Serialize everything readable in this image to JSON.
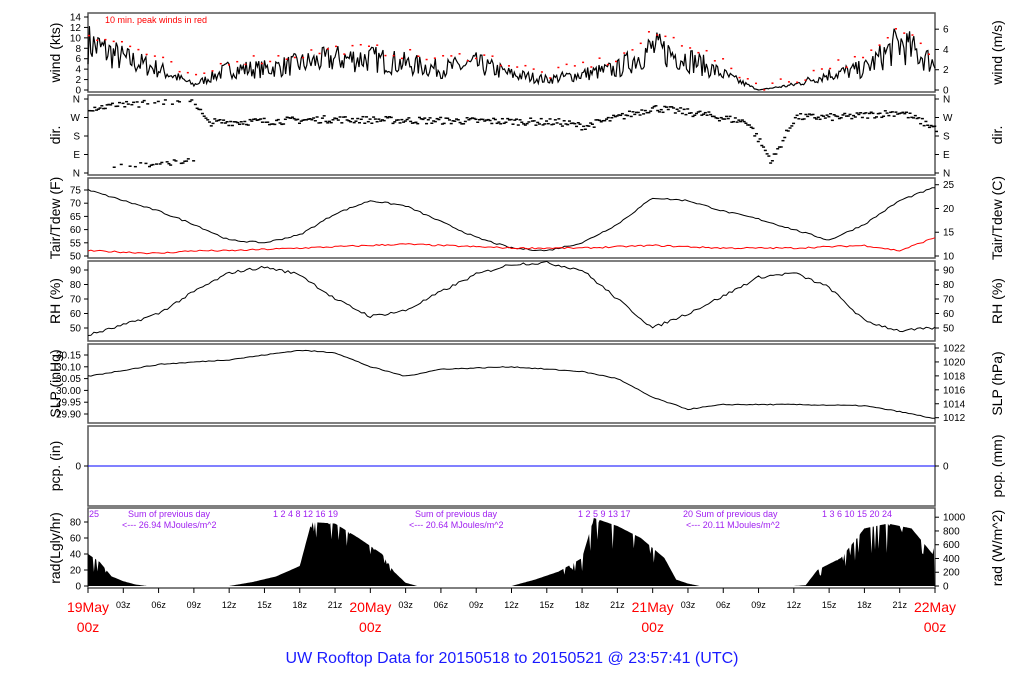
{
  "title": "UW Rooftop Data for 20150518  to  20150521 @ 23:57:41  (UTC)",
  "chart_data": [
    {
      "type": "line",
      "id": "wind",
      "ylabel": "wind (kts)",
      "ylabel_right": "wind (m/s)",
      "ylim": [
        0,
        14
      ],
      "yticks": [
        0,
        2,
        4,
        6,
        8,
        10,
        12,
        14
      ],
      "yticks_right": [
        0,
        2,
        4,
        6
      ],
      "annotation": "10 min. peak winds in red",
      "hours": [
        0,
        3,
        6,
        9,
        12,
        15,
        18,
        21,
        24,
        27,
        30,
        33,
        36,
        39,
        42,
        45,
        48,
        51,
        54,
        57,
        60,
        63,
        66,
        69,
        72
      ],
      "series": [
        {
          "name": "wind",
          "color": "#000000",
          "values": [
            9,
            6,
            4,
            1,
            4,
            4,
            5,
            6,
            6,
            5,
            4,
            5,
            3,
            2,
            3,
            4,
            8,
            6,
            3,
            0,
            1,
            3,
            4,
            9,
            5
          ]
        },
        {
          "name": "peak",
          "color": "#ff0000",
          "values": [
            11,
            9,
            6,
            2,
            6,
            6,
            7,
            8,
            8,
            7,
            6,
            7,
            5,
            3,
            5,
            6,
            11,
            9,
            5,
            1,
            2,
            5,
            6,
            12,
            7
          ]
        }
      ]
    },
    {
      "type": "scatter",
      "id": "dir",
      "ylabel": "dir.",
      "ylim": [
        0,
        360
      ],
      "yticklabels": [
        "N",
        "E",
        "S",
        "W",
        "N"
      ],
      "hours": [
        0,
        3,
        6,
        9,
        10,
        15,
        20,
        24,
        30,
        36,
        40,
        42,
        44,
        48,
        52,
        56,
        58,
        60,
        64,
        66,
        69,
        72
      ],
      "values": [
        320,
        335,
        350,
        345,
        250,
        255,
        265,
        262,
        258,
        255,
        250,
        230,
        260,
        320,
        290,
        250,
        60,
        275,
        275,
        285,
        300,
        220
      ]
    },
    {
      "type": "line",
      "id": "temp",
      "ylabel": "Tair/Tdew (F)",
      "ylabel_right": "Tair/Tdew (C)",
      "ylim": [
        49,
        77
      ],
      "yticks": [
        50,
        55,
        60,
        65,
        70,
        75
      ],
      "yticks_right": [
        10,
        15,
        20,
        25
      ],
      "hours": [
        0,
        3,
        6,
        9,
        12,
        15,
        18,
        21,
        24,
        27,
        30,
        33,
        36,
        39,
        42,
        45,
        48,
        51,
        54,
        57,
        60,
        63,
        66,
        69,
        72
      ],
      "series": [
        {
          "name": "Tair",
          "color": "#000000",
          "values": [
            75,
            71,
            67,
            62,
            56,
            55,
            58,
            66,
            71,
            69,
            63,
            57,
            53,
            52,
            55,
            62,
            72,
            71,
            67,
            64,
            60,
            56,
            62,
            71,
            76
          ]
        },
        {
          "name": "Tdew",
          "color": "#ff0000",
          "values": [
            52,
            51.5,
            51,
            52,
            52,
            52.5,
            53,
            53.5,
            54,
            54.5,
            54,
            53.5,
            53,
            53,
            53,
            53.5,
            54,
            53.5,
            53,
            53,
            53,
            53.5,
            54,
            52,
            57
          ]
        }
      ]
    },
    {
      "type": "line",
      "id": "rh",
      "ylabel": "RH (%)",
      "ylim": [
        43,
        97
      ],
      "yticks": [
        50,
        60,
        70,
        80,
        90
      ],
      "hours": [
        0,
        3,
        6,
        9,
        12,
        15,
        18,
        21,
        24,
        27,
        30,
        33,
        36,
        39,
        42,
        45,
        48,
        51,
        54,
        57,
        60,
        63,
        66,
        69,
        72
      ],
      "series": [
        {
          "name": "RH",
          "color": "#000000",
          "values": [
            45,
            52,
            60,
            75,
            88,
            92,
            87,
            70,
            58,
            62,
            75,
            87,
            94,
            95,
            90,
            70,
            50,
            60,
            72,
            85,
            88,
            78,
            55,
            48,
            50
          ]
        }
      ]
    },
    {
      "type": "line",
      "id": "slp",
      "ylabel": "SLP (inHg)",
      "ylabel_right": "SLP (hPa)",
      "ylim": [
        29.87,
        30.19
      ],
      "yticks": [
        29.9,
        29.95,
        30.0,
        30.05,
        30.1,
        30.15
      ],
      "yticks_right": [
        1012,
        1014,
        1016,
        1018,
        1020,
        1022
      ],
      "hours": [
        0,
        6,
        12,
        18,
        21,
        24,
        27,
        30,
        36,
        42,
        45,
        48,
        51,
        54,
        60,
        66,
        69,
        72
      ],
      "series": [
        {
          "name": "SLP",
          "color": "#000000",
          "values": [
            30.06,
            30.11,
            30.13,
            30.17,
            30.16,
            30.1,
            30.06,
            30.09,
            30.1,
            30.08,
            30.05,
            29.97,
            29.92,
            29.94,
            29.94,
            29.935,
            29.91,
            29.88
          ]
        }
      ]
    },
    {
      "type": "line",
      "id": "pcp",
      "ylabel": "pcp. (in)",
      "ylabel_right": "pcp. (mm)",
      "yticks": [
        0
      ],
      "yticks_right": [
        0
      ],
      "hours": [
        0,
        72
      ],
      "series": [
        {
          "name": "pcp",
          "color": "#0000ff",
          "values": [
            0,
            0
          ]
        }
      ]
    },
    {
      "type": "area",
      "id": "rad",
      "ylabel": "rad(Lgly/hr)",
      "ylabel_right": "rad (W/m^2)",
      "ylim": [
        0,
        90
      ],
      "yticks": [
        0,
        20,
        40,
        60,
        80
      ],
      "yticks_right": [
        0,
        200,
        400,
        600,
        800,
        1000
      ],
      "hours": [
        0,
        1,
        2,
        3,
        4,
        5,
        12,
        14,
        16,
        18,
        19,
        21,
        23,
        25,
        26,
        27,
        28,
        36,
        38,
        40,
        42,
        43,
        45,
        47,
        49,
        50,
        51,
        52,
        60,
        61,
        62,
        64,
        66,
        68,
        70,
        71.8,
        72
      ],
      "values": [
        40,
        30,
        12,
        6,
        2,
        0,
        0,
        5,
        12,
        25,
        80,
        78,
        60,
        40,
        18,
        4,
        0,
        0,
        8,
        18,
        35,
        85,
        75,
        60,
        35,
        8,
        3,
        0,
        0,
        1,
        20,
        35,
        72,
        78,
        72,
        40,
        55
      ],
      "annotations": [
        {
          "sum_label": "Sum of previous day",
          "total": "<--- 26.94 MJoules/m^2",
          "hour_marks": "25",
          "marks": "1    2    4   8   12   16   19"
        },
        {
          "sum_label": "Sum of previous day",
          "total": "<--- 20.64 MJoules/m^2",
          "marks": "1    2    5   9   13   17"
        },
        {
          "sum_label": "20 Sum of previous day",
          "total": "<--- 20.11 MJoules/m^2",
          "marks": "1    3    6   10   15   20   24"
        }
      ]
    }
  ],
  "x_axis": {
    "hour_labels": [
      "03z",
      "06z",
      "09z",
      "12z",
      "15z",
      "18z",
      "21z"
    ],
    "day_labels": [
      {
        "date": "19May",
        "time": "00z"
      },
      {
        "date": "20May",
        "time": "00z"
      },
      {
        "date": "21May",
        "time": "00z"
      },
      {
        "date": "22May",
        "time": "00z"
      }
    ]
  }
}
